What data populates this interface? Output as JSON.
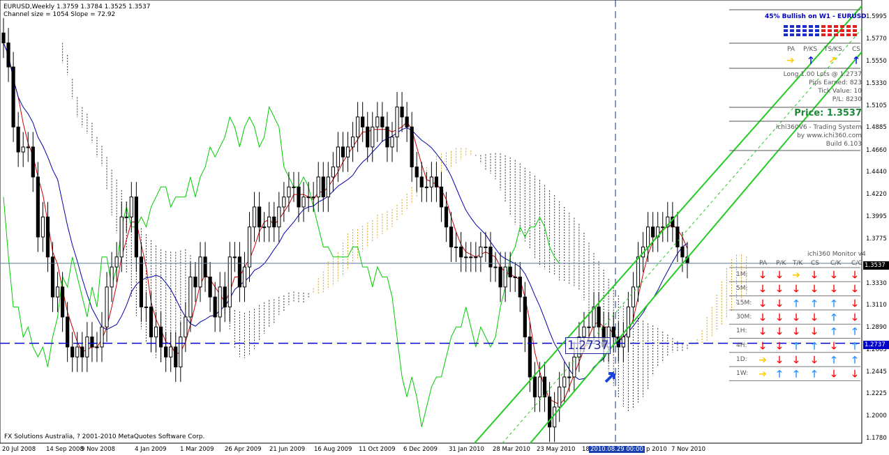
{
  "header": {
    "line1": "EURUSD,Weekly  1.3759 1.3784 1.3525 1.3537",
    "line2": "Channel size = 1054 Slope = 72.92"
  },
  "copyright": "FX Solutions Australia, ? 2001-2010 MetaQuotes Software Corp.",
  "summary_panel": {
    "bullish": "45% Bullish on W1 - EURUSD",
    "signal_headers": [
      "PA",
      "P/KS",
      "TS/KS",
      "CS"
    ],
    "signal_arrows": [
      "right-yellow",
      "up-blue",
      "up-yellow",
      "up-blue"
    ],
    "position": "Long 1.00 Lots @ 1.2737",
    "pips": "Pips Earned: 823",
    "tick_value": "Tick Value: 10",
    "pl": "P/L: 8230",
    "price": "Price: 1.3537",
    "system_name": "ichi360V6 - Trading System",
    "system_url": "by www.ichi360.com",
    "build": "Build 6.103"
  },
  "monitor": {
    "title": "ichi360 Monitor v4",
    "columns": [
      "PA",
      "P/K",
      "T/K",
      "CS",
      "C/K",
      "C/C"
    ],
    "rows": [
      {
        "tf": "1M:",
        "signals": [
          "down-red",
          "down-red",
          "right-yellow",
          "down-red",
          "down-red",
          "down-red"
        ]
      },
      {
        "tf": "5M:",
        "signals": [
          "down-red",
          "down-red",
          "down-red",
          "down-red",
          "down-red",
          "down-red"
        ]
      },
      {
        "tf": "15M:",
        "signals": [
          "down-red",
          "down-red",
          "up-blue",
          "up-blue",
          "up-blue",
          "down-red"
        ]
      },
      {
        "tf": "30M:",
        "signals": [
          "down-red",
          "down-red",
          "down-red",
          "down-red",
          "up-blue",
          "down-red"
        ]
      },
      {
        "tf": "1H:",
        "signals": [
          "down-red",
          "down-red",
          "down-red",
          "down-red",
          "up-blue",
          "up-blue"
        ]
      },
      {
        "tf": "4H:",
        "signals": [
          "down-red",
          "down-red",
          "up-blue",
          "up-blue",
          "down-red",
          "up-blue"
        ]
      },
      {
        "tf": "1D:",
        "signals": [
          "right-yellow",
          "down-red",
          "down-red",
          "down-red",
          "up-blue",
          "up-blue"
        ]
      },
      {
        "tf": "1W:",
        "signals": [
          "right-yellow",
          "up-blue",
          "up-blue",
          "up-blue",
          "down-red",
          "down-red"
        ]
      }
    ]
  },
  "entry_label": "1.2737",
  "colors": {
    "tenkan": "#cc0000",
    "kijun": "#0000aa",
    "chikou": "#00cc00",
    "kumo_bull": "#d4a017",
    "kumo_bear": "#333333",
    "channel": "#22cc22",
    "up_arrow": "#1e90ff",
    "down_arrow": "#ff0000",
    "neutral_arrow": "#ffcc00"
  },
  "chart_data": {
    "type": "candlestick",
    "symbol": "EURUSD",
    "timeframe": "Weekly",
    "ohlc_current": {
      "open": 1.3759,
      "high": 1.3784,
      "low": 1.3525,
      "close": 1.3537
    },
    "ylim": [
      1.178,
      1.61
    ],
    "y_ticks": [
      "1.5995",
      "1.5770",
      "1.5550",
      "1.5330",
      "1.5105",
      "1.4885",
      "1.4660",
      "1.4440",
      "1.4220",
      "1.3995",
      "1.3775",
      "1.3330",
      "1.3110",
      "1.2890",
      "1.2665",
      "1.2445",
      "1.2225",
      "1.2000",
      "1.1780"
    ],
    "x_ticks": [
      "20 Jul 2008",
      "14 Sep 2008",
      "9 Nov 2008",
      "4 Jan 2009",
      "1 Mar 2009",
      "26 Apr 2009",
      "21 Jun 2009",
      "16 Aug 2009",
      "11 Oct 2009",
      "6 Dec 2009",
      "31 Jan 2010",
      "28 Mar 2010",
      "23 May 2010",
      "18",
      "2010.08.29 00:00",
      "p 2010",
      "7 Nov 2010"
    ],
    "current_price": "1.3537",
    "entry_price": "1.2737",
    "cursor_time": "2010.08.29 00:00",
    "close_series": [
      1.574,
      1.55,
      1.49,
      1.465,
      1.47,
      1.47,
      1.44,
      1.38,
      1.4,
      1.36,
      1.32,
      1.33,
      1.3,
      1.27,
      1.26,
      1.27,
      1.26,
      1.28,
      1.27,
      1.27,
      1.29,
      1.33,
      1.35,
      1.36,
      1.4,
      1.4,
      1.42,
      1.36,
      1.31,
      1.31,
      1.28,
      1.29,
      1.27,
      1.26,
      1.27,
      1.25,
      1.28,
      1.3,
      1.34,
      1.33,
      1.36,
      1.34,
      1.32,
      1.3,
      1.33,
      1.31,
      1.36,
      1.36,
      1.33,
      1.35,
      1.39,
      1.41,
      1.39,
      1.39,
      1.4,
      1.39,
      1.41,
      1.42,
      1.43,
      1.43,
      1.41,
      1.42,
      1.42,
      1.42,
      1.44,
      1.42,
      1.44,
      1.45,
      1.47,
      1.46,
      1.47,
      1.48,
      1.5,
      1.49,
      1.47,
      1.49,
      1.5,
      1.49,
      1.47,
      1.48,
      1.51,
      1.5,
      1.49,
      1.45,
      1.44,
      1.43,
      1.43,
      1.44,
      1.43,
      1.41,
      1.39,
      1.37,
      1.37,
      1.36,
      1.36,
      1.36,
      1.36,
      1.37,
      1.37,
      1.35,
      1.35,
      1.33,
      1.35,
      1.34,
      1.34,
      1.32,
      1.28,
      1.24,
      1.22,
      1.24,
      1.22,
      1.19,
      1.21,
      1.23,
      1.24,
      1.24,
      1.26,
      1.28,
      1.29,
      1.29,
      1.31,
      1.29,
      1.27,
      1.29,
      1.28,
      1.27,
      1.28,
      1.31,
      1.33,
      1.36,
      1.37,
      1.39,
      1.38,
      1.39,
      1.39,
      1.4,
      1.39,
      1.37,
      1.36,
      1.3537
    ]
  }
}
